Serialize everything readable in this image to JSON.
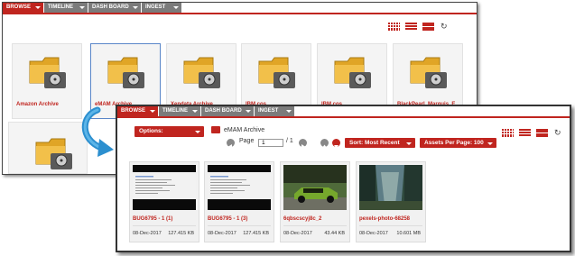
{
  "back_window": {
    "tabs": [
      {
        "label": "BROWSE",
        "active": true
      },
      {
        "label": "TIMELINE",
        "active": false
      },
      {
        "label": "DASH BOARD",
        "active": false
      },
      {
        "label": "INGEST",
        "active": false
      }
    ],
    "tiles": [
      {
        "label": "Amazon Archive"
      },
      {
        "label": "eMAM Archive"
      },
      {
        "label": "Xendata Archive"
      },
      {
        "label": "IBM cos"
      },
      {
        "label": "IBM cos"
      },
      {
        "label": "BlackPearl_Marquis_E..."
      }
    ],
    "view_icons": [
      "grid-view-icon",
      "list-view-icon",
      "detail-view-icon",
      "refresh-icon"
    ]
  },
  "front_window": {
    "tabs": [
      {
        "label": "BROWSE",
        "active": true
      },
      {
        "label": "TIMELINE",
        "active": false
      },
      {
        "label": "DASH BOARD",
        "active": false
      },
      {
        "label": "INGEST",
        "active": false
      }
    ],
    "options_label": "Options:",
    "breadcrumb_label": "eMAM Archive",
    "page_label": "Page",
    "page_value": "1",
    "page_total": "/ 1",
    "sort_label": "Sort: Most Recent",
    "per_page_label": "Assets Per Page: 100",
    "assets": [
      {
        "name": "BUG6795 - 1 (1)",
        "date": "08-Dec-2017",
        "size": "127.415 KB",
        "thumb": "screenshot"
      },
      {
        "name": "BUG6795 - 1 (3)",
        "date": "08-Dec-2017",
        "size": "127.415 KB",
        "thumb": "screenshot"
      },
      {
        "name": "6qbscscyj8c_2",
        "date": "08-Dec-2017",
        "size": "43.44 KB",
        "thumb": "car-photo"
      },
      {
        "name": "pexels-photo-68258",
        "date": "08-Dec-2017",
        "size": "10.601 MB",
        "thumb": "forest-photo"
      }
    ]
  },
  "colors": {
    "accent": "#c0251f",
    "tab_inactive": "#7b7b7b",
    "selection": "#5a86c8"
  }
}
